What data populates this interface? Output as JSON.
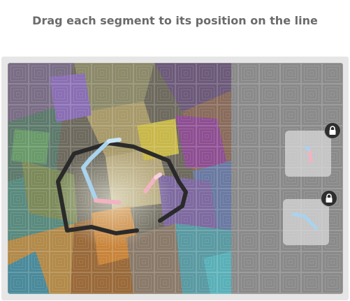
{
  "instruction": {
    "text": "Drag each segment to its position on the line"
  },
  "puzzle": {
    "board": "collage-background",
    "tray_pieces": [
      {
        "name": "pink-segment",
        "locked": true
      },
      {
        "name": "blue-curve-segment",
        "locked": true
      }
    ]
  },
  "colors": {
    "prompt_text": "#6b6b6b",
    "frame": "#e6e6e6",
    "line": "#2a2a2a",
    "blue_segment": "#a9d3ee",
    "pink_segment": "#f2b3c1",
    "lock_badge": "#2e2e2e"
  },
  "icons": [
    "lock-icon"
  ]
}
